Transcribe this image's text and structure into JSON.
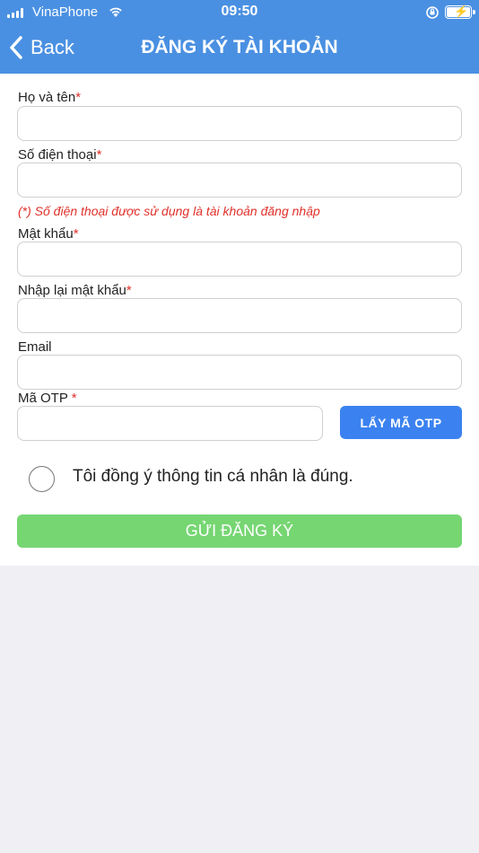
{
  "status_bar": {
    "carrier": "VinaPhone",
    "time": "09:50"
  },
  "header": {
    "back_label": "Back",
    "title": "ĐĂNG KÝ TÀI KHOẢN",
    "background_color": "#4a90e2"
  },
  "form": {
    "fields": [
      {
        "label": "Họ và tên",
        "required": "*",
        "value": ""
      },
      {
        "label": "Số điện thoại",
        "required": "*",
        "value": ""
      },
      {
        "label": "Mật khẩu",
        "required": "*",
        "value": ""
      },
      {
        "label": "Nhập lại mật khẩu",
        "required": "*",
        "value": ""
      },
      {
        "label": "Email",
        "value": ""
      },
      {
        "label": "Mã OTP",
        "required": " *",
        "value": ""
      }
    ],
    "phone_note": "(*) Số điện thoại được sử dụng là tài khoản đăng nhập",
    "otp_button": "LẤY MÃ OTP",
    "agree_text": "Tôi đồng ý thông tin cá nhân là đúng.",
    "agree_checked": false,
    "submit_button": "GỬI ĐĂNG KÝ"
  },
  "colors": {
    "required": "#e0302a",
    "otp_button": "#3b82f0",
    "submit_button": "#76d672"
  }
}
